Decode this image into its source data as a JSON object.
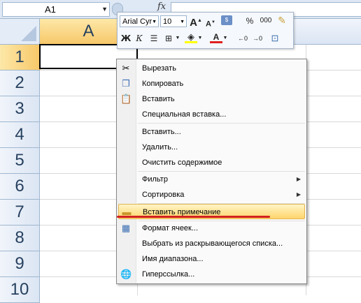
{
  "name_box": {
    "value": "A1"
  },
  "formula_bar": {
    "fx_label": "fx",
    "value": ""
  },
  "columns": [
    {
      "label": "A"
    }
  ],
  "rows": [
    "1",
    "2",
    "3",
    "4",
    "5",
    "6",
    "7",
    "8",
    "9",
    "10"
  ],
  "mini_toolbar": {
    "font_name": "Arial Cyr",
    "font_size": "10",
    "bold_label": "Ж",
    "italic_label": "К",
    "percent_label": "%",
    "thousands_label": "000",
    "font_color_label": "A"
  },
  "context_menu": {
    "items": [
      {
        "label": "Вырезать",
        "icon": "scissors-icon"
      },
      {
        "label": "Копировать",
        "icon": "copy-icon"
      },
      {
        "label": "Вставить",
        "icon": "paste-icon"
      },
      {
        "label": "Специальная вставка..."
      },
      {
        "label": "Вставить..."
      },
      {
        "label": "Удалить..."
      },
      {
        "label": "Очистить содержимое"
      },
      {
        "label": "Фильтр",
        "submenu": true
      },
      {
        "label": "Сортировка",
        "submenu": true
      },
      {
        "label": "Вставить примечание",
        "icon": "comment-icon",
        "highlighted": true
      },
      {
        "label": "Формат ячеек...",
        "icon": "format-cells-icon"
      },
      {
        "label": "Выбрать из раскрывающегося списка..."
      },
      {
        "label": "Имя диапазона..."
      },
      {
        "label": "Гиперссылка...",
        "icon": "hyperlink-icon"
      }
    ]
  },
  "colors": {
    "highlight": "#ffd56b",
    "underline_annotation": "#d32020",
    "selected_header": "#f7c86a"
  }
}
